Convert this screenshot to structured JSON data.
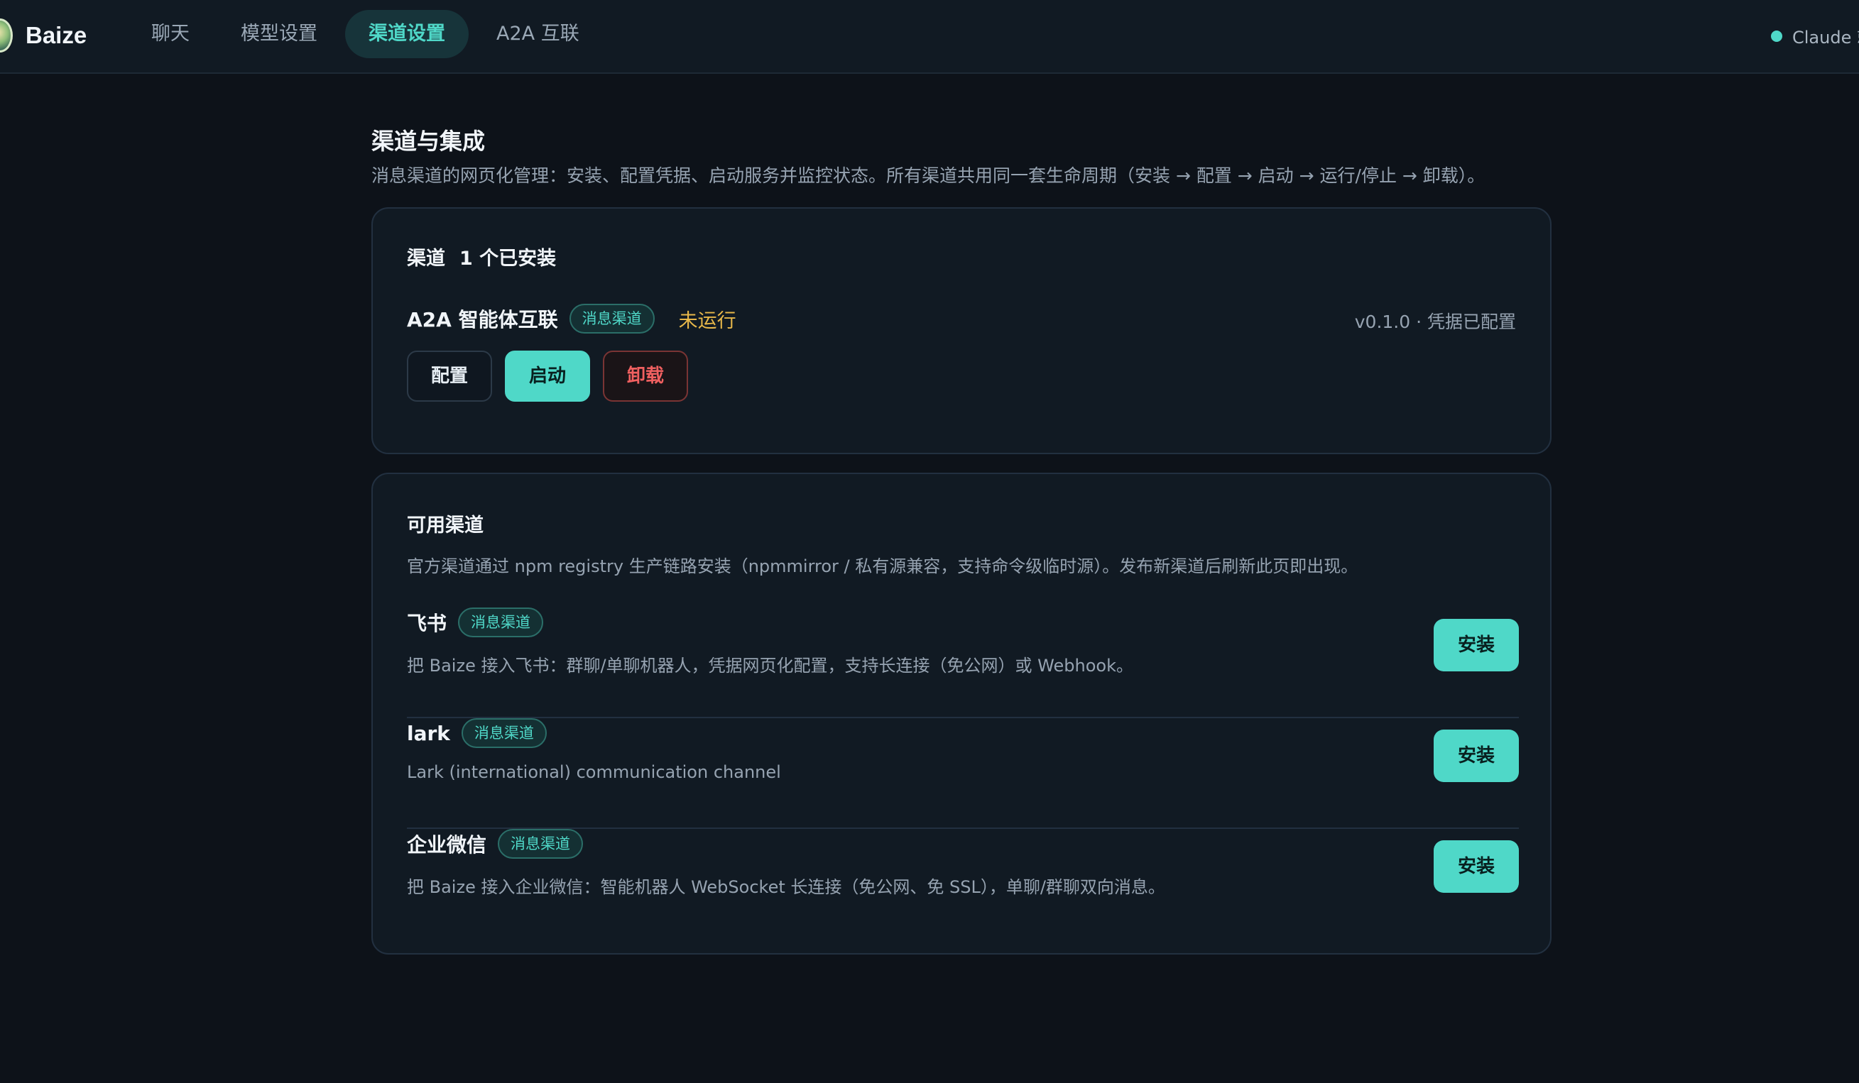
{
  "app": {
    "name": "Baize",
    "logo": "baize-logo"
  },
  "nav": {
    "tabs": [
      {
        "label": "聊天",
        "active": false
      },
      {
        "label": "模型设置",
        "active": false
      },
      {
        "label": "渠道设置",
        "active": true
      },
      {
        "label": "A2A 互联",
        "active": false
      }
    ]
  },
  "status": {
    "label": "Claude 就",
    "dot_color": "#4fd8c8"
  },
  "page": {
    "title": "渠道与集成",
    "description": "消息渠道的网页化管理：安装、配置凭据、启动服务并监控状态。所有渠道共用同一套生命周期（安装 → 配置 → 启动 → 运行/停止 → 卸载）。"
  },
  "installed": {
    "heading": "渠道",
    "count_label": "1 个已安装",
    "channel": {
      "name": "A2A 智能体互联",
      "tag": "消息渠道",
      "run_state": "未运行",
      "meta": "v0.1.0 · 凭据已配置",
      "buttons": {
        "config": "配置",
        "start": "启动",
        "uninstall": "卸载"
      }
    }
  },
  "available": {
    "heading": "可用渠道",
    "description": "官方渠道通过 npm registry 生产链路安装（npmmirror / 私有源兼容，支持命令级临时源）。发布新渠道后刷新此页即出现。",
    "items": [
      {
        "name": "飞书",
        "tag": "消息渠道",
        "description": "把 Baize 接入飞书：群聊/单聊机器人，凭据网页化配置，支持长连接（免公网）或 Webhook。",
        "button": "安装"
      },
      {
        "name": "lark",
        "tag": "消息渠道",
        "description": "Lark (international) communication channel",
        "button": "安装"
      },
      {
        "name": "企业微信",
        "tag": "消息渠道",
        "description": "把 Baize 接入企业微信：智能机器人 WebSocket 长连接（免公网、免 SSL），单聊/群聊双向消息。",
        "button": "安装"
      }
    ]
  },
  "colors": {
    "background": "#0d1219",
    "surface": "#111a23",
    "accent": "#4fd8c8",
    "warning": "#e8b84a",
    "danger": "#f06060"
  }
}
